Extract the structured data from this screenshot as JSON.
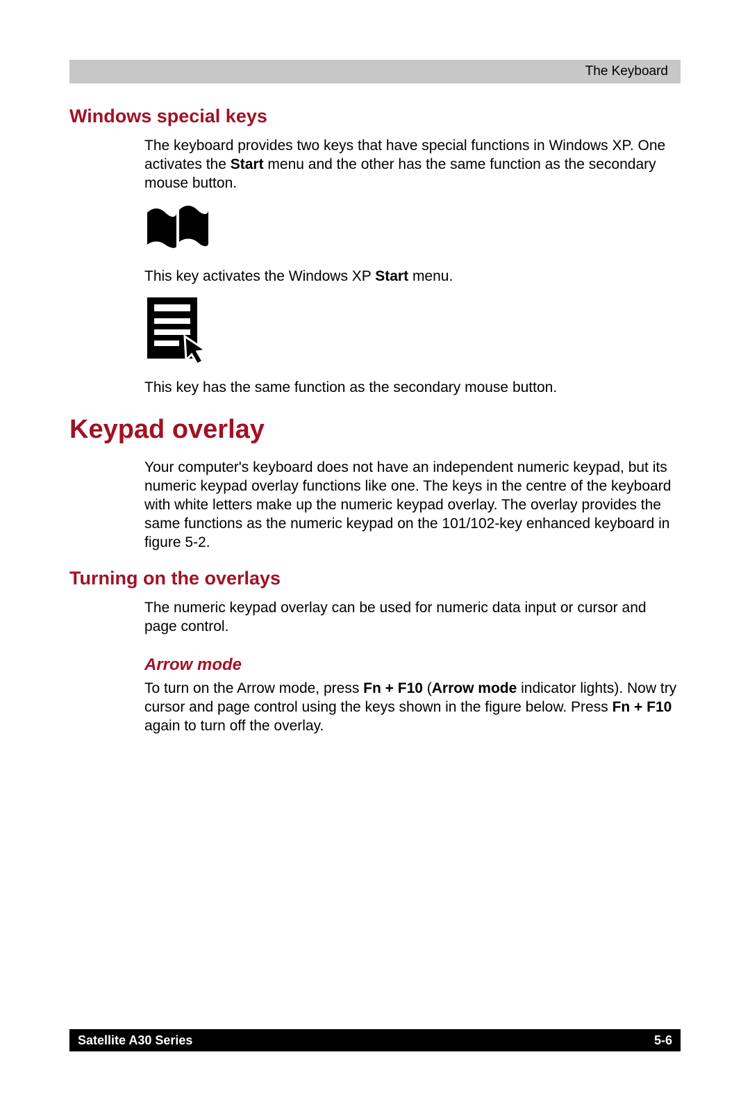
{
  "header": {
    "right": "The Keyboard"
  },
  "sections": {
    "winkeys": {
      "heading": "Windows special keys",
      "intro_a": "The keyboard provides two keys that have special functions in Windows XP. One activates the ",
      "intro_bold1": "Start",
      "intro_b": " menu and the other has the same function as the secondary mouse button.",
      "cap1_a": "This key activates the Windows XP ",
      "cap1_bold": "Start",
      "cap1_b": " menu.",
      "cap2": "This key has the same function as the secondary mouse button."
    },
    "keypad": {
      "heading": "Keypad overlay",
      "para": "Your computer's keyboard does not have an independent numeric keypad, but its numeric keypad overlay functions like one. The keys in the centre of the keyboard with white letters make up the numeric keypad overlay. The overlay provides the same functions as the numeric keypad on the 101/102-key enhanced keyboard in figure 5-2."
    },
    "turning": {
      "heading": "Turning on the overlays",
      "para": "The numeric keypad overlay can be used for numeric data input or cursor and page control."
    },
    "arrow": {
      "heading": "Arrow mode",
      "p_a": "To turn on the Arrow mode, press ",
      "p_b1": "Fn + F10",
      "p_b": " (",
      "p_b2": "Arrow mode",
      "p_c": " indicator lights). Now try cursor and page control using the keys shown in the figure below. Press ",
      "p_b3": "Fn + F10",
      "p_d": " again to turn off the overlay."
    }
  },
  "footer": {
    "left": "Satellite A30 Series",
    "right": "5-6"
  }
}
